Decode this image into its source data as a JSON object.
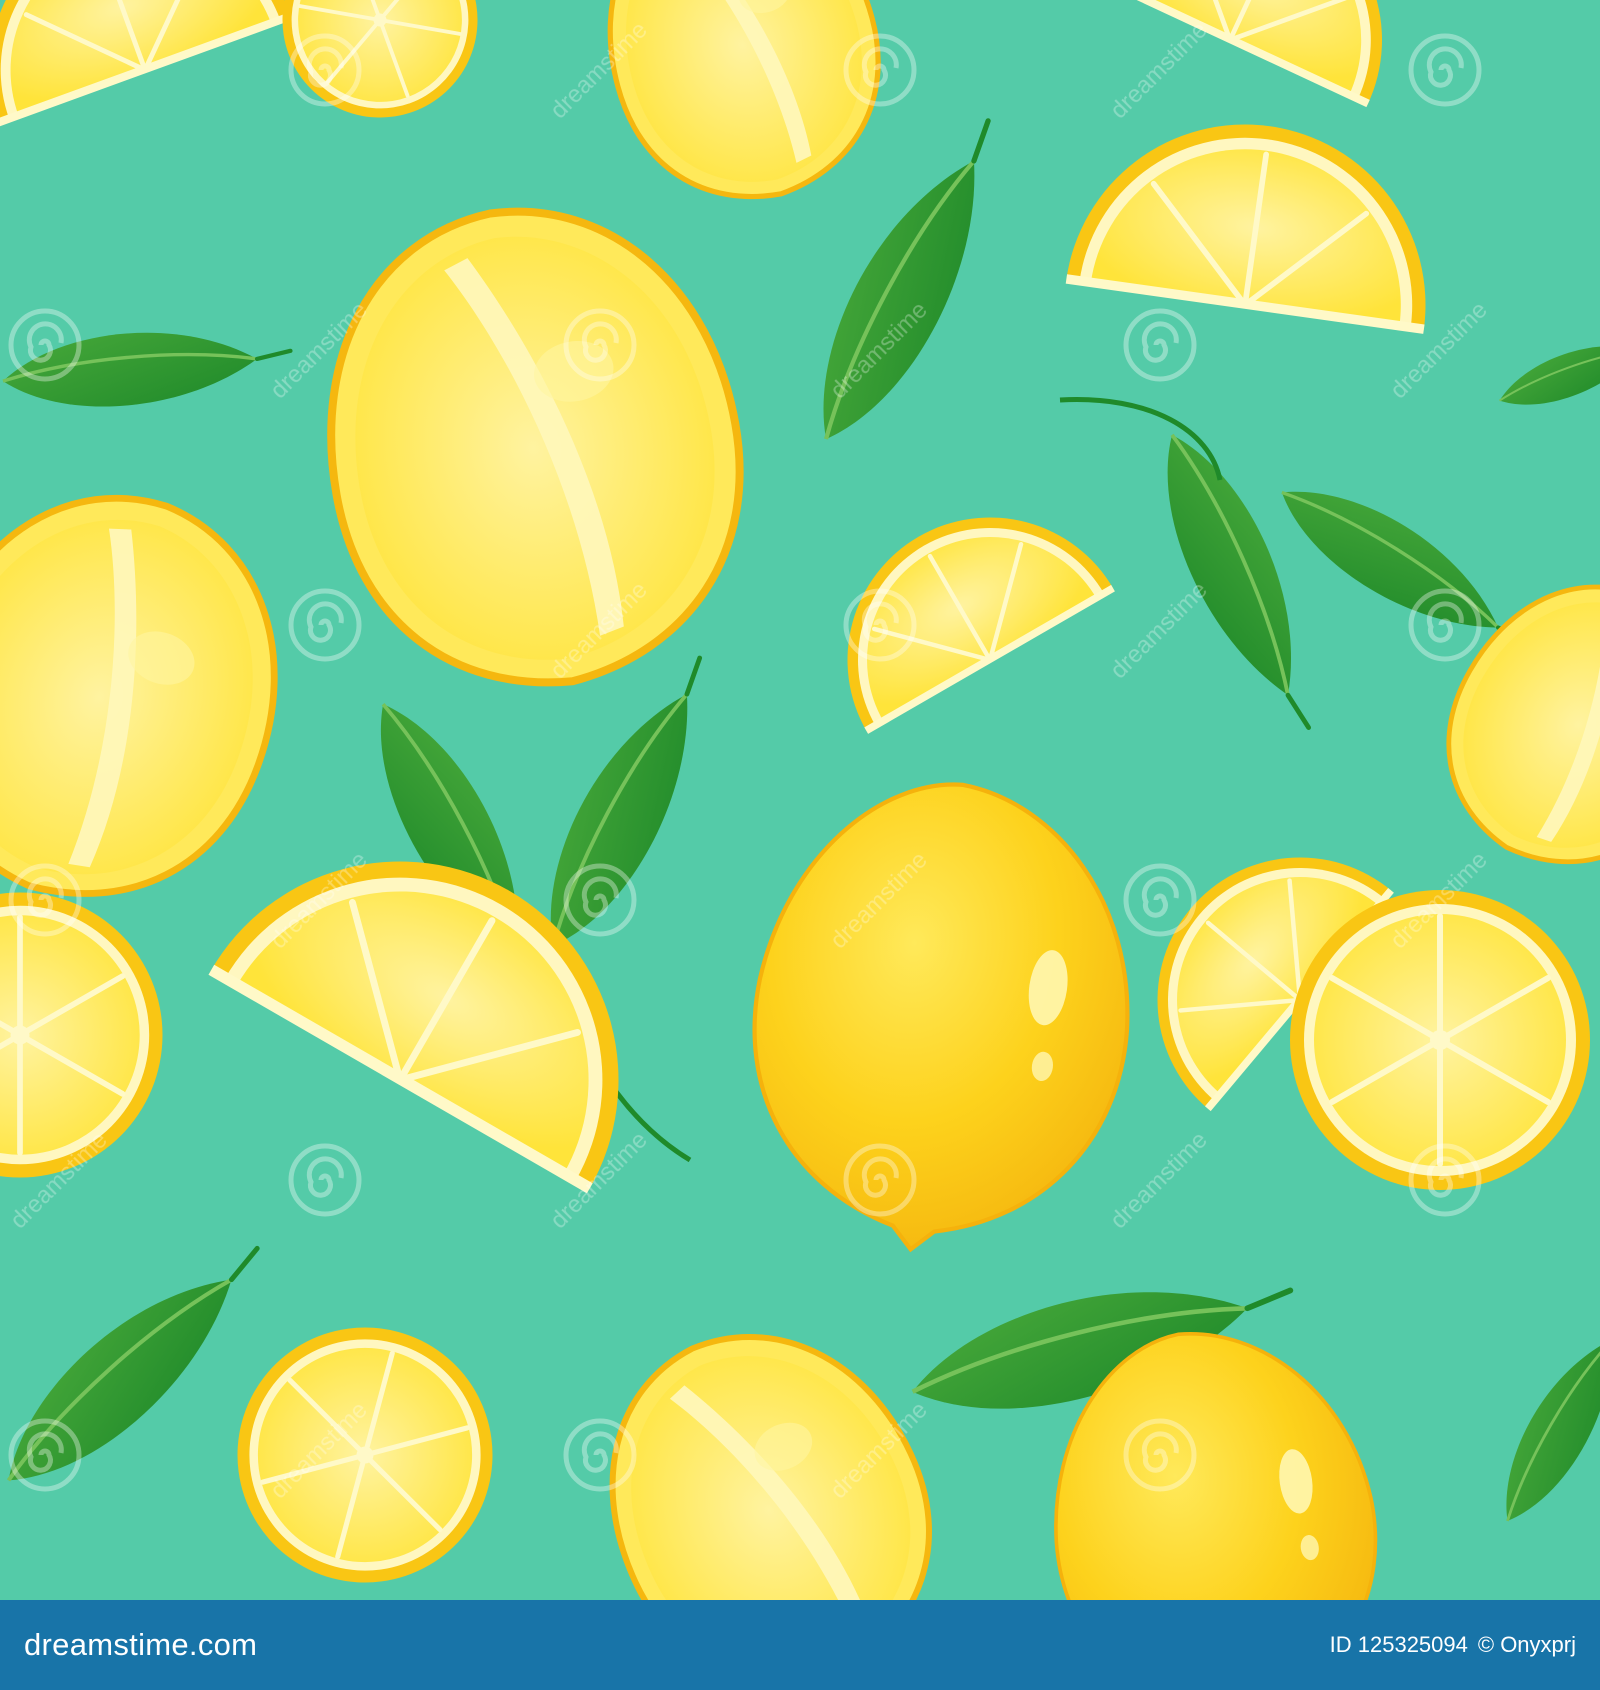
{
  "colors": {
    "background": "#54cba8",
    "lemon_peel": "#f5b70f",
    "lemon_mid": "#fdd21c",
    "lemon_highlight": "#ffe95a",
    "flesh_outer": "#fff07a",
    "flesh_inner": "#ffe53a",
    "segment_line": "#fff9c8",
    "leaf_dark": "#1f8a2a",
    "leaf_light": "#47a83a",
    "footer_bg": "#1874a8",
    "footer_text": "#ffffff"
  },
  "watermark": {
    "text": "dreamstime",
    "icon": "spiral-logo-icon"
  },
  "footer": {
    "site": "dreamstime.com",
    "id_text": "ID 125325094",
    "credit": "© Onyxprj"
  },
  "illustration": {
    "subject": "seamless pattern of lemons, lemon slices and green leaves"
  }
}
